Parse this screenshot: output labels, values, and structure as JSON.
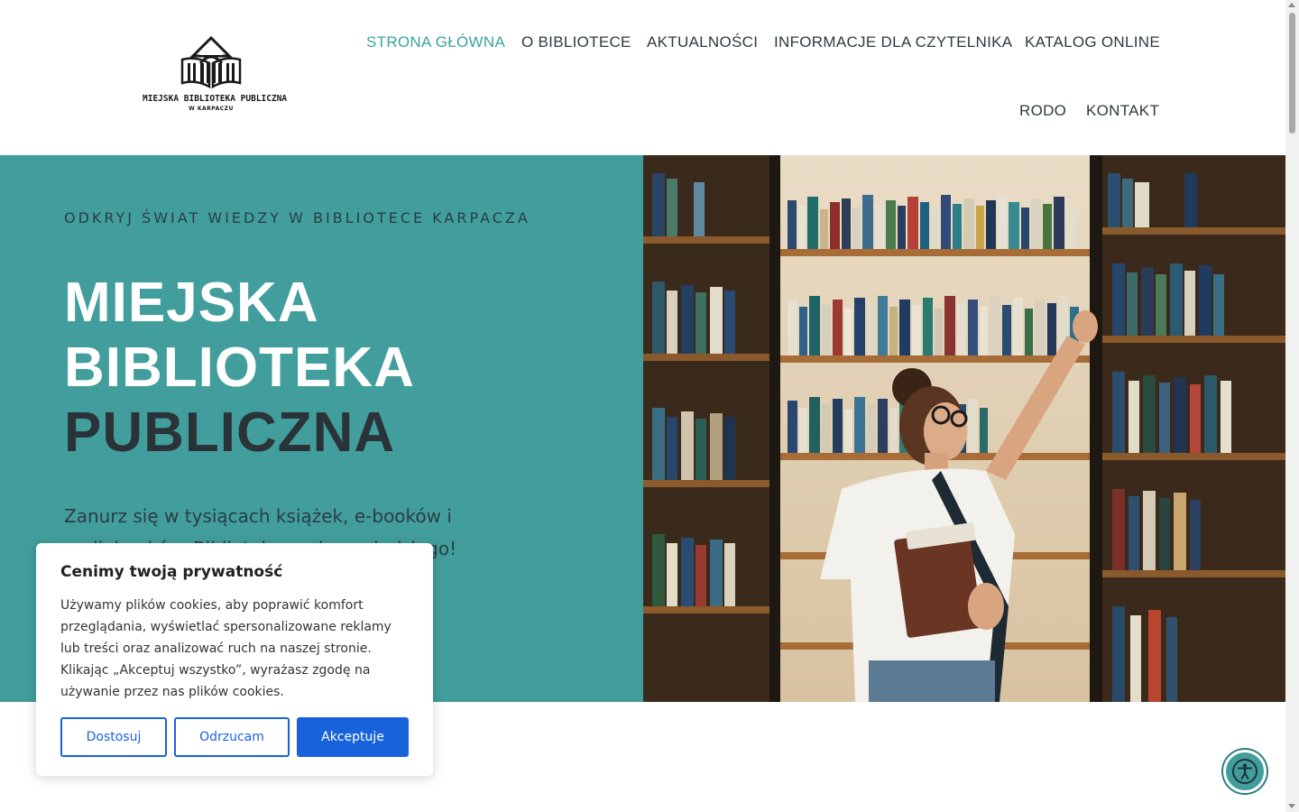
{
  "logo": {
    "title": "MIEJSKA BIBLIOTEKA PUBLICZNA",
    "subtitle": "W KARPACZU",
    "icon": "library-building-icon"
  },
  "nav": {
    "items": [
      {
        "label": "STRONA GŁÓWNA",
        "active": true
      },
      {
        "label": "O BIBLIOTECE",
        "active": false
      },
      {
        "label": "AKTUALNOŚCI",
        "active": false
      },
      {
        "label": "INFORMACJE DLA CZYTELNIKA",
        "active": false
      },
      {
        "label": "KATALOG ONLINE",
        "active": false
      },
      {
        "label": "RODO",
        "active": false
      },
      {
        "label": "KONTAKT",
        "active": false
      }
    ]
  },
  "hero": {
    "kicker": "ODKRYJ ŚWIAT WIEDZY W BIBLIOTECE KARPACZA",
    "title_line1": "MIEJSKA",
    "title_line2": "BIBLIOTEKA",
    "title_line3": "PUBLICZNA",
    "description": "Zanurz się w tysiącach książek, e-booków i audiobooków. Biblioteka czeka na każdego!",
    "image": "woman-reaching-for-book-on-library-shelf"
  },
  "cookie": {
    "title": "Cenimy twoją prywatność",
    "text": "Używamy plików cookies, aby poprawić komfort przeglądania, wyświetlać spersonalizowane reklamy lub treści oraz analizować ruch na naszej stronie. Klikając „Akceptuj wszystko”, wyrażasz zgodę na używanie przez nas plików cookies.",
    "customize_label": "Dostosuj",
    "reject_label": "Odrzucam",
    "accept_label": "Akceptuje"
  },
  "accessibility": {
    "icon": "accessibility-person-icon"
  },
  "colors": {
    "teal": "#429e9c",
    "nav_active": "#3aa39d",
    "dark_text": "#2a3438",
    "cookie_blue": "#1863dc"
  }
}
